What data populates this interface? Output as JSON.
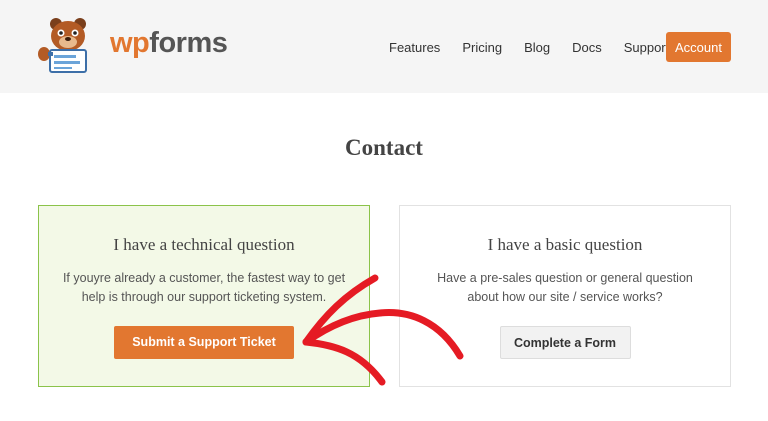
{
  "brand": {
    "logo_wp": "wp",
    "logo_forms": "forms",
    "accent": "#e27730"
  },
  "nav": {
    "items": [
      "Features",
      "Pricing",
      "Blog",
      "Docs",
      "Support"
    ],
    "account_label": "Account"
  },
  "page": {
    "title": "Contact"
  },
  "cards": {
    "technical": {
      "title": "I have a technical question",
      "desc_line1": "If youyre already a customer, the fastest way to get",
      "desc_line2": "help is through our support ticketing system.",
      "button": "Submit a Support Ticket"
    },
    "basic": {
      "title": "I have a basic question",
      "desc_line1": "Have a pre-sales question or general question",
      "desc_line2": "about how our site / service works?",
      "button": "Complete a Form"
    }
  },
  "annotation": {
    "arrow_color": "#e51b24"
  }
}
